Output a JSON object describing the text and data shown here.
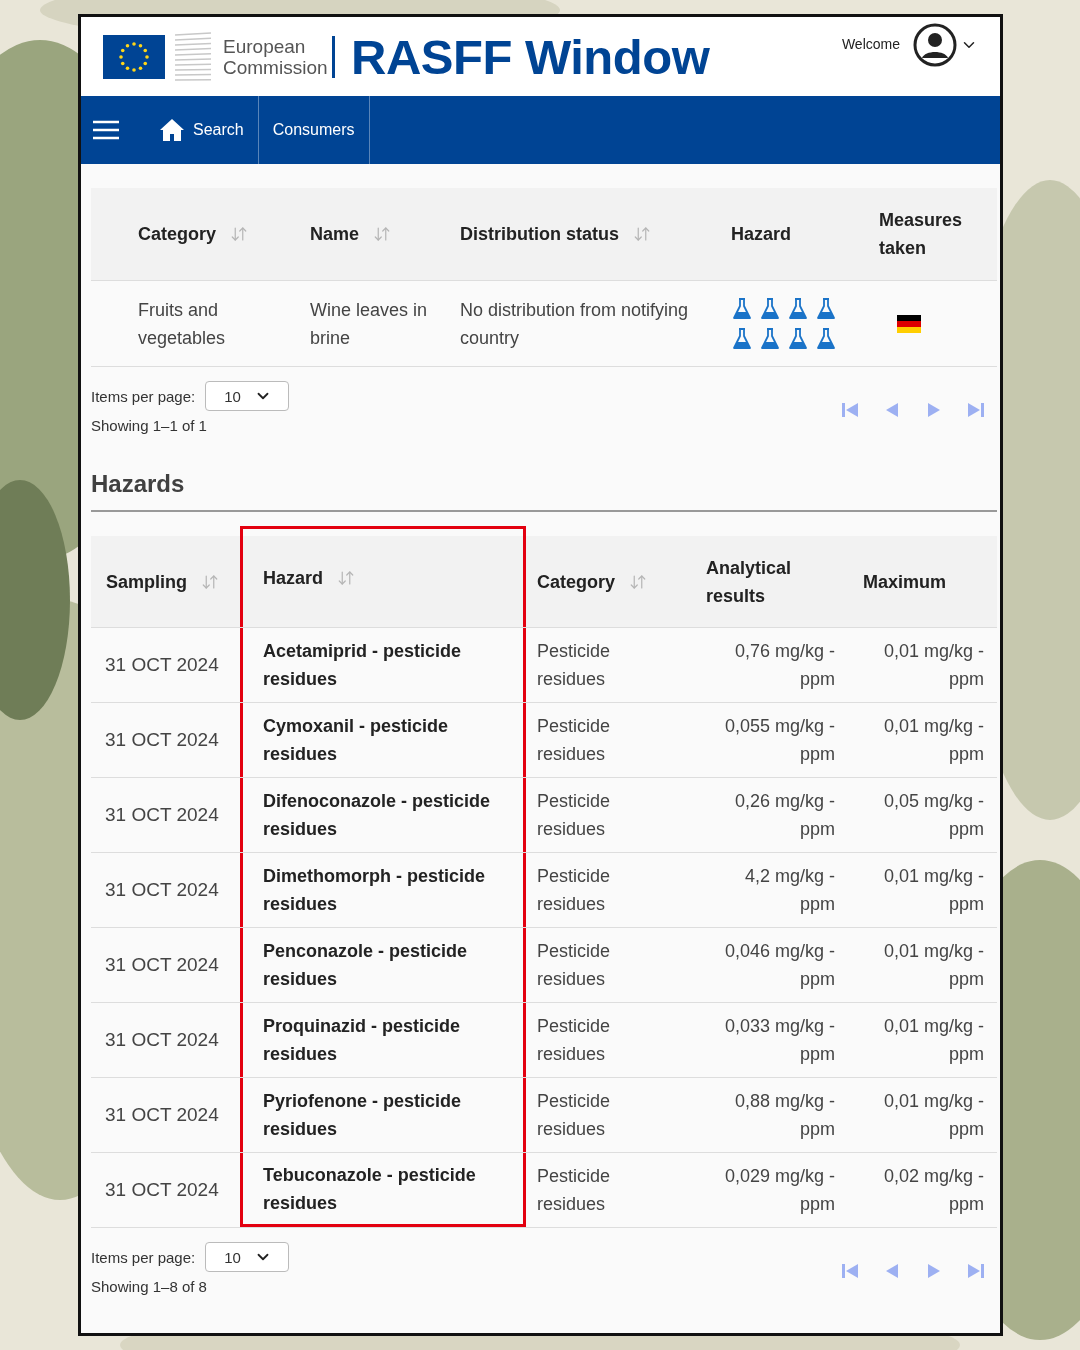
{
  "header": {
    "brand": "European Commission",
    "title": "RASFF Window",
    "welcome": "Welcome"
  },
  "nav": {
    "items": [
      {
        "label": "Search",
        "kind": "home"
      },
      {
        "label": "Consumers",
        "kind": "text"
      }
    ]
  },
  "notification": {
    "columns": [
      {
        "label": "Category",
        "sortable": true
      },
      {
        "label": "Name",
        "sortable": true
      },
      {
        "label": "Distribution status",
        "sortable": true
      },
      {
        "label": "Hazard",
        "sortable": false
      },
      {
        "label": "Measures taken",
        "sortable": false
      }
    ],
    "rows": [
      {
        "cells": [
          "Fruits and vegetables",
          "Wine leaves in brine",
          "No distribution from notifying country"
        ]
      }
    ],
    "pagination": {
      "label": "Items per page:",
      "page_size": "10",
      "showing": "Showing 1–1 of 1",
      "disabled": true
    }
  },
  "hazards": {
    "title": "Hazards",
    "columns": [
      {
        "label": "Sampling",
        "sortable": true,
        "highlighted": false
      },
      {
        "label": "Hazard",
        "sortable": true,
        "highlighted": true
      },
      {
        "label": "Category",
        "sortable": true,
        "highlighted": false
      },
      {
        "label": "Analytical results",
        "sortable": false,
        "highlighted": false
      },
      {
        "label": "Maximum",
        "sortable": false,
        "highlighted": false
      }
    ],
    "rows": [
      {
        "cells": [
          "31 OCT 2024",
          "Acetamiprid - pesticide residues",
          "Pesticide residues",
          "0,76 mg/kg - ppm",
          "0,01 mg/kg - ppm"
        ]
      },
      {
        "cells": [
          "31 OCT 2024",
          "Cymoxanil - pesticide residues",
          "Pesticide residues",
          "0,055 mg/kg - ppm",
          "0,01 mg/kg - ppm"
        ]
      },
      {
        "cells": [
          "31 OCT 2024",
          "Difenoconazole - pesticide residues",
          "Pesticide residues",
          "0,26 mg/kg - ppm",
          "0,05 mg/kg - ppm"
        ]
      },
      {
        "cells": [
          "31 OCT 2024",
          "Dimethomorph - pesticide residues",
          "Pesticide residues",
          "4,2 mg/kg - ppm",
          "0,01 mg/kg - ppm"
        ]
      },
      {
        "cells": [
          "31 OCT 2024",
          "Penconazole - pesticide residues",
          "Pesticide residues",
          "0,046 mg/kg - ppm",
          "0,01 mg/kg - ppm"
        ]
      },
      {
        "cells": [
          "31 OCT 2024",
          "Proquinazid - pesticide residues",
          "Pesticide residues",
          "0,033 mg/kg - ppm",
          "0,01 mg/kg - ppm"
        ]
      },
      {
        "cells": [
          "31 OCT 2024",
          "Pyriofenone - pesticide residues",
          "Pesticide residues",
          "0,88 mg/kg - ppm",
          "0,01 mg/kg - ppm"
        ]
      },
      {
        "cells": [
          "31 OCT 2024",
          "Tebuconazole - pesticide residues",
          "Pesticide residues",
          "0,029 mg/kg - ppm",
          "0,02 mg/kg - ppm"
        ]
      }
    ],
    "pagination": {
      "label": "Items per page:",
      "page_size": "10",
      "showing": "Showing 1–8 of 8",
      "disabled": true
    }
  }
}
